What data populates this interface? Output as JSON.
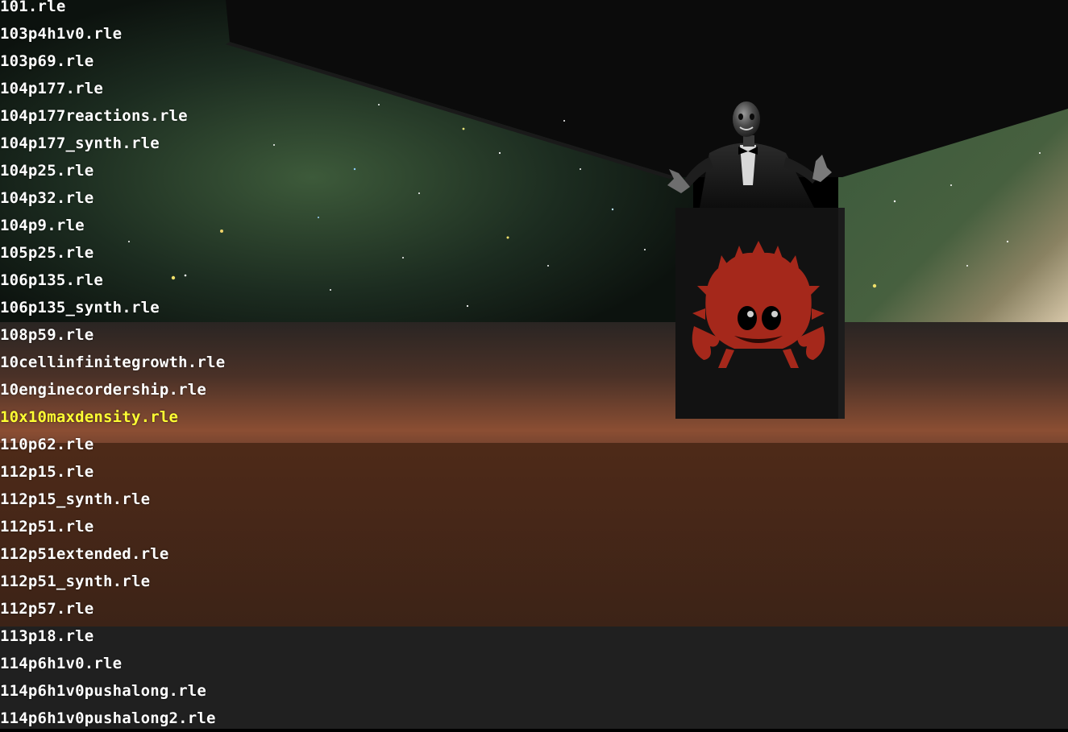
{
  "file_browser": {
    "selected_index": 15,
    "items": [
      "101.rle",
      "103p4h1v0.rle",
      "103p69.rle",
      "104p177.rle",
      "104p177reactions.rle",
      "104p177_synth.rle",
      "104p25.rle",
      "104p32.rle",
      "104p9.rle",
      "105p25.rle",
      "106p135.rle",
      "106p135_synth.rle",
      "108p59.rle",
      "10cellinfinitegrowth.rle",
      "10enginecordership.rle",
      "10x10maxdensity.rle",
      "110p62.rle",
      "112p15.rle",
      "112p15_synth.rle",
      "112p51.rle",
      "112p51extended.rle",
      "112p51_synth.rle",
      "112p57.rle",
      "113p18.rle",
      "114p6h1v0.rle",
      "114p6h1v0pushalong.rle",
      "114p6h1v0pushalong2.rle"
    ]
  },
  "colors": {
    "text": "#ffffff",
    "selected_text": "#ffff33",
    "crab": "#a5281b",
    "pedestal": "#121212"
  },
  "scene": {
    "background": "space-skybox",
    "podium_emblem": "crab-icon",
    "figure": "presenter-figure"
  }
}
